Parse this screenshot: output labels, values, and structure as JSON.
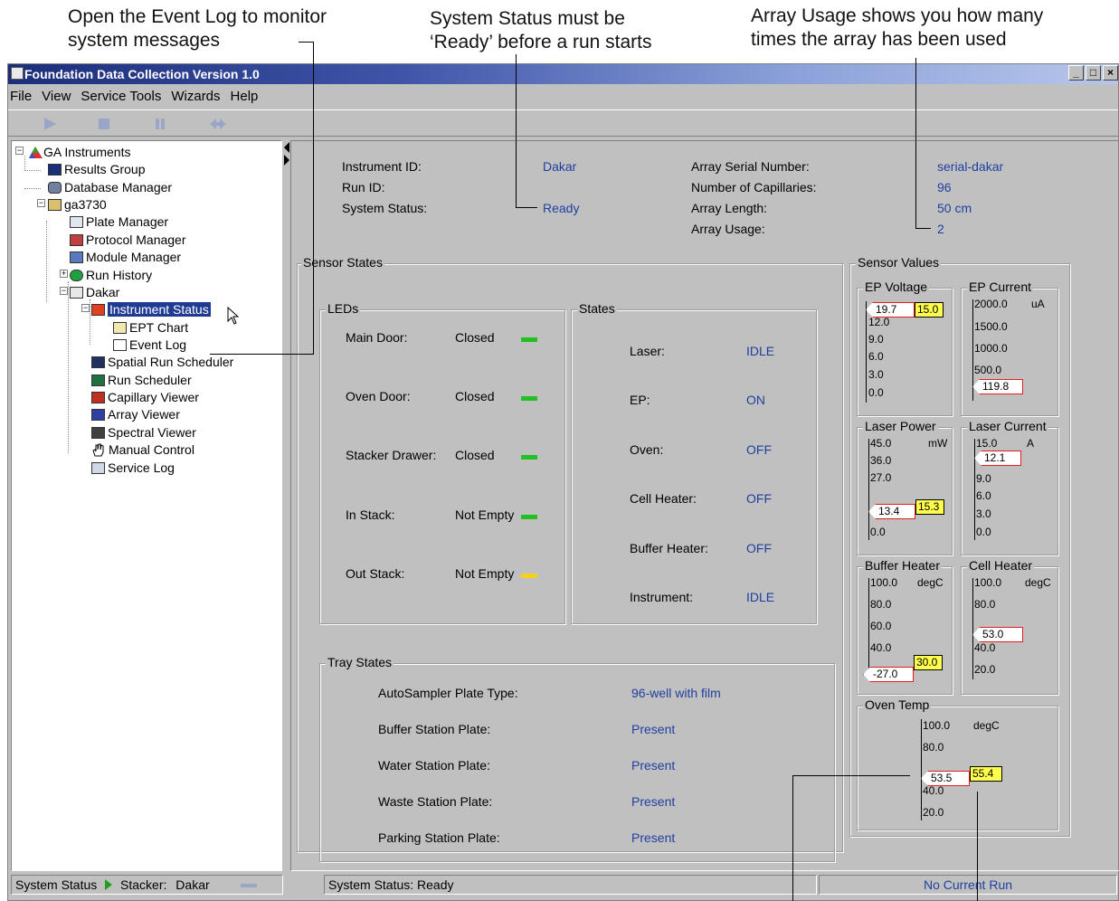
{
  "callouts": {
    "event_log": "Open the Event Log to monitor\nsystem messages",
    "system_status": "System Status must be\n‘Ready’ before a run starts",
    "array_usage": "Array Usage shows you how many\ntimes the array has been used"
  },
  "window": {
    "title": "Foundation Data Collection Version 1.0",
    "controls": [
      "_",
      "□",
      "×"
    ]
  },
  "menu": [
    "File",
    "View",
    "Service Tools",
    "Wizards",
    "Help"
  ],
  "toolbar": {
    "buttons": [
      "play-icon",
      "stop-icon",
      "pause-icon",
      "skip-icon"
    ]
  },
  "tree": {
    "root": "GA Instruments",
    "results_group": "Results Group",
    "database_manager": "Database Manager",
    "computer": "ga3730",
    "plate_manager": "Plate Manager",
    "protocol_manager": "Protocol Manager",
    "module_manager": "Module Manager",
    "run_history": "Run History",
    "instrument": "Dakar",
    "instrument_status": "Instrument Status",
    "ept_chart": "EPT Chart",
    "event_log": "Event Log",
    "spatial_run_scheduler": "Spatial Run Scheduler",
    "run_scheduler": "Run Scheduler",
    "capillary_viewer": "Capillary Viewer",
    "array_viewer": "Array Viewer",
    "spectral_viewer": "Spectral Viewer",
    "manual_control": "Manual Control",
    "service_log": "Service Log",
    "expand_minus": "−",
    "expand_plus": "+"
  },
  "info": {
    "instrument_id_label": "Instrument ID:",
    "instrument_id": "Dakar",
    "run_id_label": "Run ID:",
    "system_status_label": "System Status:",
    "system_status": "Ready",
    "array_serial_label": "Array Serial Number:",
    "array_serial": "serial-dakar",
    "capillaries_label": "Number of Capillaries:",
    "capillaries": "96",
    "array_length_label": "Array Length:",
    "array_length": "50  cm",
    "array_usage_label": "Array Usage:",
    "array_usage": "2"
  },
  "sensor_states": {
    "title": "Sensor States",
    "leds_title": "LEDs",
    "leds": [
      {
        "label": "Main Door:",
        "value": "Closed",
        "color": "#22c022"
      },
      {
        "label": "Oven Door:",
        "value": "Closed",
        "color": "#22c022"
      },
      {
        "label": "Stacker Drawer:",
        "value": "Closed",
        "color": "#22c022"
      },
      {
        "label": "In Stack:",
        "value": "Not Empty",
        "color": "#22c022"
      },
      {
        "label": "Out Stack:",
        "value": "Not Empty",
        "color": "#f0d020"
      }
    ],
    "states_title": "States",
    "states": [
      {
        "label": "Laser:",
        "value": "IDLE"
      },
      {
        "label": "EP:",
        "value": "ON"
      },
      {
        "label": "Oven:",
        "value": "OFF"
      },
      {
        "label": "Cell Heater:",
        "value": "OFF"
      },
      {
        "label": "Buffer Heater:",
        "value": "OFF"
      },
      {
        "label": "Instrument:",
        "value": "IDLE"
      }
    ]
  },
  "tray_states": {
    "title": "Tray States",
    "rows": [
      {
        "label": "AutoSampler Plate Type:",
        "value": "96-well with film"
      },
      {
        "label": "Buffer Station Plate:",
        "value": "Present"
      },
      {
        "label": "Water Station Plate:",
        "value": "Present"
      },
      {
        "label": "Waste Station Plate:",
        "value": "Present"
      },
      {
        "label": "Parking Station Plate:",
        "value": "Present"
      }
    ]
  },
  "sensor_values": {
    "title": "Sensor Values",
    "ep_voltage": {
      "title": "EP Voltage",
      "ticks": [
        "12.0",
        "9.0",
        "6.0",
        "3.0",
        "0.0"
      ],
      "pointer": "19.7",
      "setpoint": "15.0"
    },
    "ep_current": {
      "title": "EP Current",
      "unit": "uA",
      "ticks": [
        "2000.0",
        "1500.0",
        "1000.0",
        "500.0"
      ],
      "pointer": "119.8"
    },
    "laser_power": {
      "title": "Laser Power",
      "unit": "mW",
      "ticks": [
        "45.0",
        "36.0",
        "27.0",
        "0.0"
      ],
      "pointer": "13.4",
      "setpoint": "15.3"
    },
    "laser_current": {
      "title": "Laser Current",
      "unit": "A",
      "ticks": [
        "15.0",
        "9.0",
        "6.0",
        "3.0",
        "0.0"
      ],
      "pointer": "12.1"
    },
    "buffer_heater": {
      "title": "Buffer Heater",
      "unit": "degC",
      "ticks": [
        "100.0",
        "80.0",
        "60.0",
        "40.0"
      ],
      "pointer": "-27.0",
      "setpoint": "30.0"
    },
    "cell_heater": {
      "title": "Cell Heater",
      "unit": "degC",
      "ticks": [
        "100.0",
        "80.0",
        "40.0",
        "20.0"
      ],
      "pointer": "53.0"
    },
    "oven_temp": {
      "title": "Oven Temp",
      "unit": "degC",
      "ticks": [
        "100.0",
        "80.0",
        "40.0",
        "20.0"
      ],
      "pointer": "53.5",
      "setpoint": "55.4"
    }
  },
  "status_bar": {
    "system_status_label": "System Status",
    "stacker_label": "Stacker:",
    "stacker_value": "Dakar",
    "message": "System Status: Ready",
    "run": "No Current Run"
  }
}
